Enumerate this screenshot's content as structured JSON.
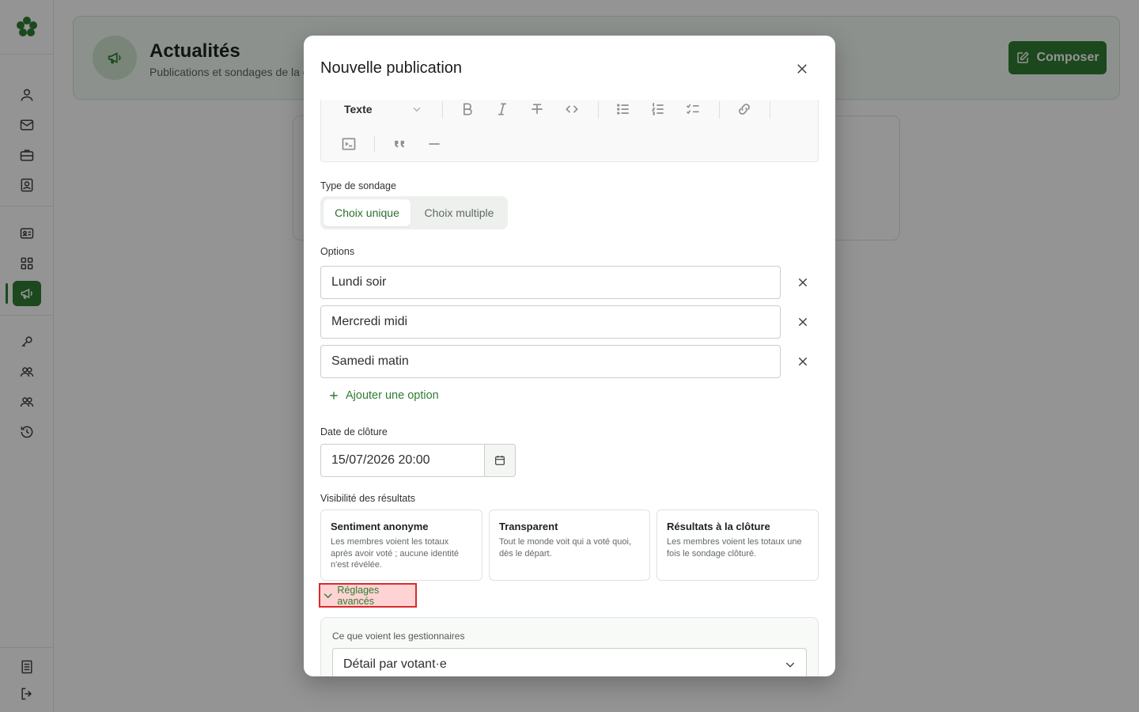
{
  "header": {
    "title": "Actualités",
    "subtitle": "Publications et sondages de la c",
    "compose_label": "Composer"
  },
  "sidebar": {
    "items": [
      {
        "icon": "user-icon"
      },
      {
        "icon": "mail-icon"
      },
      {
        "icon": "briefcase-icon"
      },
      {
        "icon": "contact-book-icon"
      },
      {
        "icon": "id-card-icon"
      },
      {
        "icon": "grid-icon"
      },
      {
        "icon": "megaphone-icon",
        "active": true
      },
      {
        "icon": "key-icon"
      },
      {
        "icon": "users-icon"
      },
      {
        "icon": "users-alt-icon"
      },
      {
        "icon": "history-icon"
      },
      {
        "icon": "document-icon"
      },
      {
        "icon": "logout-icon"
      }
    ]
  },
  "modal": {
    "title": "Nouvelle publication",
    "toolbar": {
      "text_style": "Texte"
    },
    "poll_type": {
      "label": "Type de sondage",
      "options": [
        "Choix unique",
        "Choix multiple"
      ],
      "selected": "Choix unique"
    },
    "options": {
      "label": "Options",
      "items": [
        "Lundi soir",
        "Mercredi midi",
        "Samedi matin"
      ],
      "add_label": "Ajouter une option"
    },
    "close_date": {
      "label": "Date de clôture",
      "value": "15/07/2026 20:00"
    },
    "visibility": {
      "label": "Visibilité des résultats",
      "cards": [
        {
          "title": "Sentiment anonyme",
          "desc": "Les membres voient les totaux après avoir voté ; aucune identité n'est révélée."
        },
        {
          "title": "Transparent",
          "desc": "Tout le monde voit qui a voté quoi, dès le départ."
        },
        {
          "title": "Résultats à la clôture",
          "desc": "Les membres voient les totaux une fois le sondage clôturé."
        }
      ]
    },
    "advanced": {
      "toggle_label": "Réglages avancés",
      "managers_label": "Ce que voient les gestionnaires",
      "managers_value": "Détail par votant·e"
    }
  },
  "colors": {
    "accent": "#2f7d32",
    "highlight_border": "#d92b2b",
    "highlight_fill": "#ffd3d3"
  }
}
